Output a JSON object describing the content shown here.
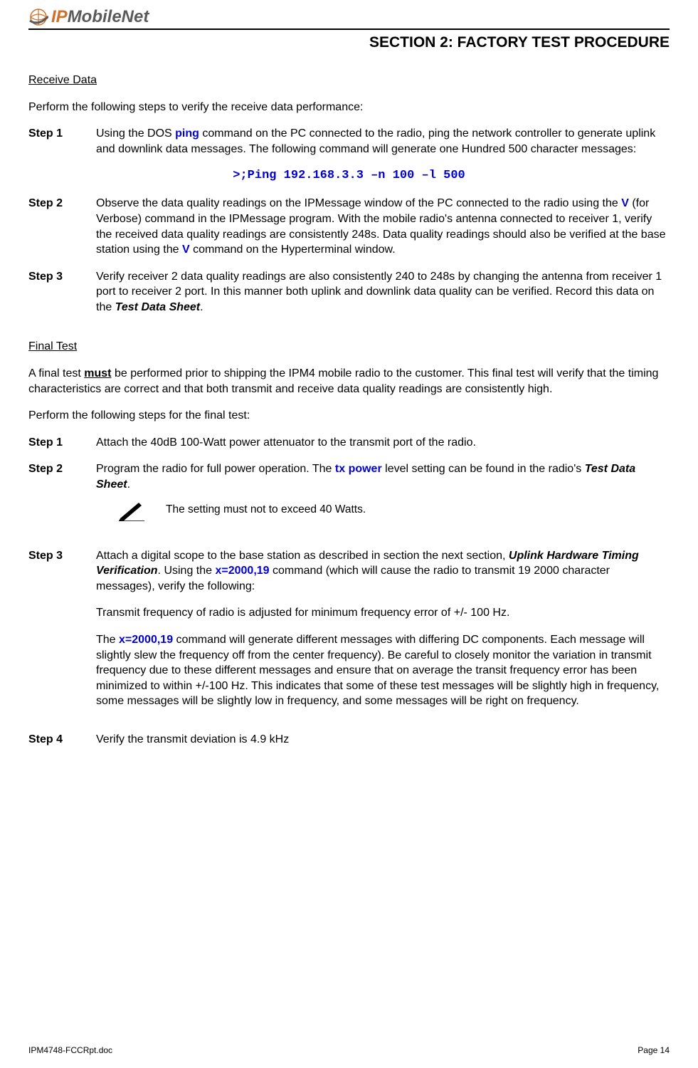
{
  "header": {
    "logo_ip": "IP",
    "logo_mobilenet": "MobileNet",
    "section_title": "SECTION 2:  FACTORY TEST PROCEDURE"
  },
  "receive_data": {
    "heading": "Receive Data",
    "intro": "Perform the following steps to verify the receive data performance:",
    "step1": {
      "label": "Step 1",
      "text_a": "Using the DOS ",
      "cmd": "ping",
      "text_b": " command on the PC connected to the radio, ping the network controller to generate uplink and downlink data messages.  The following command will generate one Hundred 500 character messages:"
    },
    "code": ">;Ping 192.168.3.3 –n 100 –l 500",
    "step2": {
      "label": "Step 2",
      "text_a": "Observe the data quality readings on the IPMessage window of the PC connected to the radio using the ",
      "cmd1": "V",
      "text_b": " (for Verbose) command in the IPMessage program.  With the mobile radio's antenna connected to receiver 1, verify the received data quality readings are consistently 248s.  Data quality readings should also be verified at the base station using the ",
      "cmd2": "V",
      "text_c": " command on the Hyperterminal window."
    },
    "step3": {
      "label": "Step 3",
      "text_a": "Verify receiver 2 data quality readings are also consistently 240 to 248s by changing the antenna from receiver 1 port to receiver 2 port.  In this manner both uplink and downlink data quality can be verified.  Record this data on the ",
      "italic": "Test Data Sheet",
      "text_b": "."
    }
  },
  "final_test": {
    "heading": "Final Test",
    "intro_a": "A final test ",
    "intro_must": "must",
    "intro_b": " be performed prior to shipping the IPM4 mobile radio to the customer.  This final test will verify that the timing characteristics are correct and that both transmit and receive data quality readings are consistently high.",
    "intro2": "Perform the following steps for the final test:",
    "step1": {
      "label": "Step 1",
      "text": "Attach the 40dB 100-Watt power attenuator to the transmit port of the radio."
    },
    "step2": {
      "label": "Step 2",
      "text_a": "Program the radio for full power operation.  The ",
      "cmd": "tx power",
      "text_b": " level setting can be found in the radio's ",
      "italic": "Test Data Sheet",
      "text_c": "."
    },
    "note": "The setting must not to exceed 40 Watts.",
    "step3": {
      "label": "Step 3",
      "p1_a": "Attach a digital scope to the base station as described in section the next section, ",
      "p1_italic": "Uplink Hardware Timing Verification",
      "p1_b": ".  Using the ",
      "p1_cmd": "x=2000,19",
      "p1_c": " command (which will cause the radio to transmit 19 2000 character messages), verify the following:",
      "p2": "Transmit frequency of radio is adjusted for minimum frequency error of +/- 100 Hz.",
      "p3_a": "The ",
      "p3_cmd": "x=2000,19",
      "p3_b": " command will generate different messages with differing DC components.  Each message will slightly slew the frequency off from the center frequency). Be careful to closely monitor the variation in transmit frequency due to these different messages and ensure that on average the transit frequency error has been minimized to within +/-100 Hz.  This indicates that some of these test messages will be slightly high in frequency, some messages will be slightly low in frequency, and some messages will be right on frequency."
    },
    "step4": {
      "label": "Step 4",
      "text": "Verify the transmit deviation is 4.9 kHz"
    }
  },
  "footer": {
    "left": "IPM4748-FCCRpt.doc",
    "right": "Page 14"
  }
}
